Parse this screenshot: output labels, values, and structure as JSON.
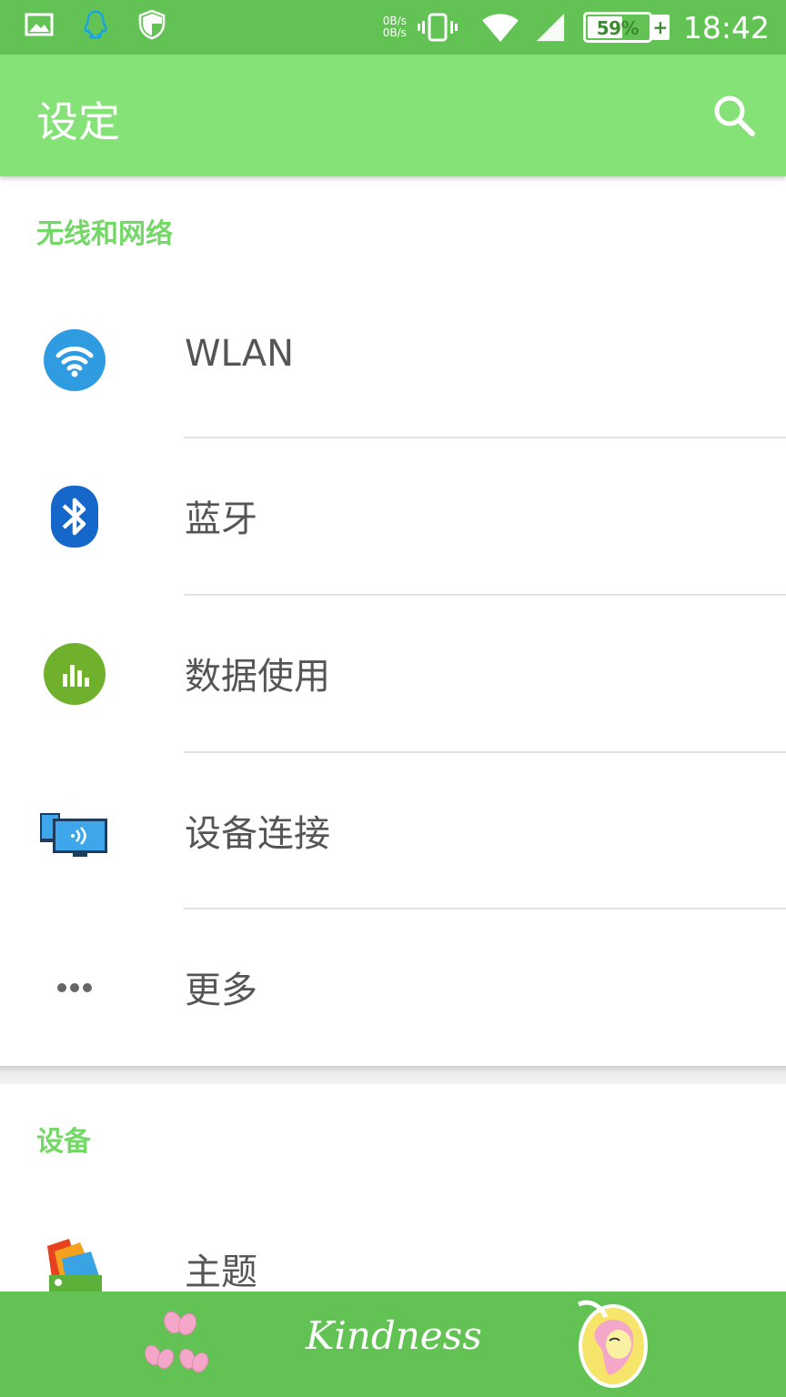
{
  "status_bar": {
    "net_up": "0B/s",
    "net_down": "0B/s",
    "battery_percent": "59%",
    "time": "18:42",
    "icons": [
      "image-icon",
      "qq-icon",
      "shield-icon",
      "vibrate-icon",
      "wifi-icon",
      "signal-icon",
      "battery-icon"
    ]
  },
  "app_bar": {
    "title": "设定",
    "search_icon": "search-icon"
  },
  "sections": [
    {
      "header": "无线和网络",
      "items": [
        {
          "label": "WLAN",
          "icon": "wifi-icon"
        },
        {
          "label": "蓝牙",
          "icon": "bluetooth-icon"
        },
        {
          "label": "数据使用",
          "icon": "data-usage-icon"
        },
        {
          "label": "设备连接",
          "icon": "device-connection-icon"
        },
        {
          "label": "更多",
          "icon": "more-icon"
        }
      ]
    },
    {
      "header": "设备",
      "items": [
        {
          "label": "主题",
          "icon": "theme-icon"
        }
      ]
    }
  ],
  "bottom_bar": {
    "text": "Kindness"
  },
  "colors": {
    "status_bar": "#62c354",
    "app_bar": "#84e276",
    "section_header": "#74d867",
    "label": "#555555",
    "divider": "#e2e2e2"
  }
}
